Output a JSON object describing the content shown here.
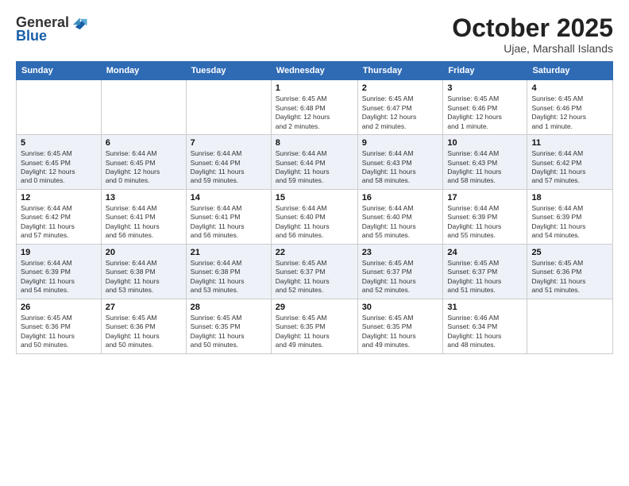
{
  "header": {
    "logo_general": "General",
    "logo_blue": "Blue",
    "month": "October 2025",
    "location": "Ujae, Marshall Islands"
  },
  "columns": [
    "Sunday",
    "Monday",
    "Tuesday",
    "Wednesday",
    "Thursday",
    "Friday",
    "Saturday"
  ],
  "weeks": [
    [
      {
        "day": "",
        "info": ""
      },
      {
        "day": "",
        "info": ""
      },
      {
        "day": "",
        "info": ""
      },
      {
        "day": "1",
        "info": "Sunrise: 6:45 AM\nSunset: 6:48 PM\nDaylight: 12 hours\nand 2 minutes."
      },
      {
        "day": "2",
        "info": "Sunrise: 6:45 AM\nSunset: 6:47 PM\nDaylight: 12 hours\nand 2 minutes."
      },
      {
        "day": "3",
        "info": "Sunrise: 6:45 AM\nSunset: 6:46 PM\nDaylight: 12 hours\nand 1 minute."
      },
      {
        "day": "4",
        "info": "Sunrise: 6:45 AM\nSunset: 6:46 PM\nDaylight: 12 hours\nand 1 minute."
      }
    ],
    [
      {
        "day": "5",
        "info": "Sunrise: 6:45 AM\nSunset: 6:45 PM\nDaylight: 12 hours\nand 0 minutes."
      },
      {
        "day": "6",
        "info": "Sunrise: 6:44 AM\nSunset: 6:45 PM\nDaylight: 12 hours\nand 0 minutes."
      },
      {
        "day": "7",
        "info": "Sunrise: 6:44 AM\nSunset: 6:44 PM\nDaylight: 11 hours\nand 59 minutes."
      },
      {
        "day": "8",
        "info": "Sunrise: 6:44 AM\nSunset: 6:44 PM\nDaylight: 11 hours\nand 59 minutes."
      },
      {
        "day": "9",
        "info": "Sunrise: 6:44 AM\nSunset: 6:43 PM\nDaylight: 11 hours\nand 58 minutes."
      },
      {
        "day": "10",
        "info": "Sunrise: 6:44 AM\nSunset: 6:43 PM\nDaylight: 11 hours\nand 58 minutes."
      },
      {
        "day": "11",
        "info": "Sunrise: 6:44 AM\nSunset: 6:42 PM\nDaylight: 11 hours\nand 57 minutes."
      }
    ],
    [
      {
        "day": "12",
        "info": "Sunrise: 6:44 AM\nSunset: 6:42 PM\nDaylight: 11 hours\nand 57 minutes."
      },
      {
        "day": "13",
        "info": "Sunrise: 6:44 AM\nSunset: 6:41 PM\nDaylight: 11 hours\nand 56 minutes."
      },
      {
        "day": "14",
        "info": "Sunrise: 6:44 AM\nSunset: 6:41 PM\nDaylight: 11 hours\nand 56 minutes."
      },
      {
        "day": "15",
        "info": "Sunrise: 6:44 AM\nSunset: 6:40 PM\nDaylight: 11 hours\nand 56 minutes."
      },
      {
        "day": "16",
        "info": "Sunrise: 6:44 AM\nSunset: 6:40 PM\nDaylight: 11 hours\nand 55 minutes."
      },
      {
        "day": "17",
        "info": "Sunrise: 6:44 AM\nSunset: 6:39 PM\nDaylight: 11 hours\nand 55 minutes."
      },
      {
        "day": "18",
        "info": "Sunrise: 6:44 AM\nSunset: 6:39 PM\nDaylight: 11 hours\nand 54 minutes."
      }
    ],
    [
      {
        "day": "19",
        "info": "Sunrise: 6:44 AM\nSunset: 6:39 PM\nDaylight: 11 hours\nand 54 minutes."
      },
      {
        "day": "20",
        "info": "Sunrise: 6:44 AM\nSunset: 6:38 PM\nDaylight: 11 hours\nand 53 minutes."
      },
      {
        "day": "21",
        "info": "Sunrise: 6:44 AM\nSunset: 6:38 PM\nDaylight: 11 hours\nand 53 minutes."
      },
      {
        "day": "22",
        "info": "Sunrise: 6:45 AM\nSunset: 6:37 PM\nDaylight: 11 hours\nand 52 minutes."
      },
      {
        "day": "23",
        "info": "Sunrise: 6:45 AM\nSunset: 6:37 PM\nDaylight: 11 hours\nand 52 minutes."
      },
      {
        "day": "24",
        "info": "Sunrise: 6:45 AM\nSunset: 6:37 PM\nDaylight: 11 hours\nand 51 minutes."
      },
      {
        "day": "25",
        "info": "Sunrise: 6:45 AM\nSunset: 6:36 PM\nDaylight: 11 hours\nand 51 minutes."
      }
    ],
    [
      {
        "day": "26",
        "info": "Sunrise: 6:45 AM\nSunset: 6:36 PM\nDaylight: 11 hours\nand 50 minutes."
      },
      {
        "day": "27",
        "info": "Sunrise: 6:45 AM\nSunset: 6:36 PM\nDaylight: 11 hours\nand 50 minutes."
      },
      {
        "day": "28",
        "info": "Sunrise: 6:45 AM\nSunset: 6:35 PM\nDaylight: 11 hours\nand 50 minutes."
      },
      {
        "day": "29",
        "info": "Sunrise: 6:45 AM\nSunset: 6:35 PM\nDaylight: 11 hours\nand 49 minutes."
      },
      {
        "day": "30",
        "info": "Sunrise: 6:45 AM\nSunset: 6:35 PM\nDaylight: 11 hours\nand 49 minutes."
      },
      {
        "day": "31",
        "info": "Sunrise: 6:46 AM\nSunset: 6:34 PM\nDaylight: 11 hours\nand 48 minutes."
      },
      {
        "day": "",
        "info": ""
      }
    ]
  ]
}
